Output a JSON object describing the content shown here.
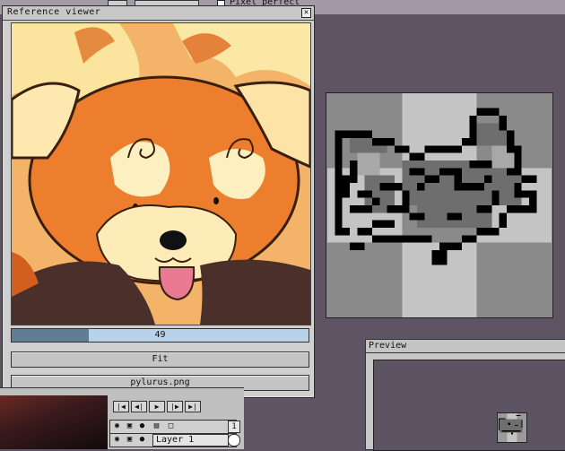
{
  "top_toolbar": {
    "pixel_perfect_label": "Pixel perfect"
  },
  "reference_viewer": {
    "title": "Reference viewer",
    "zoom": {
      "value": "49",
      "fill_fraction": 0.26
    },
    "fit_button": "Fit",
    "file_button": "pylurus.png"
  },
  "preview": {
    "title": "Preview"
  },
  "timeline": {
    "controls": [
      "first-frame",
      "prev-frame",
      "play",
      "next-frame",
      "last-frame"
    ],
    "frame_number": "1",
    "layer_name": "Layer 1"
  },
  "colors": {
    "desktop": "#5f5464",
    "panel": "#cfcfcf",
    "progress_track": "#b8d2ea",
    "progress_fill": "#5f7d93"
  }
}
